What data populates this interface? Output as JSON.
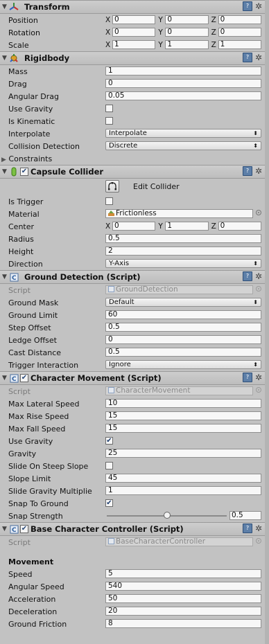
{
  "transform": {
    "title": "Transform",
    "axes": [
      "X",
      "Y",
      "Z"
    ],
    "rows": [
      {
        "label": "Position",
        "x": "0",
        "y": "0",
        "z": "0"
      },
      {
        "label": "Rotation",
        "x": "0",
        "y": "0",
        "z": "0"
      },
      {
        "label": "Scale",
        "x": "1",
        "y": "1",
        "z": "1"
      }
    ]
  },
  "rigidbody": {
    "title": "Rigidbody",
    "mass_label": "Mass",
    "mass": "1",
    "drag_label": "Drag",
    "drag": "0",
    "angular_drag_label": "Angular Drag",
    "angular_drag": "0.05",
    "use_gravity_label": "Use Gravity",
    "use_gravity": false,
    "is_kinematic_label": "Is Kinematic",
    "is_kinematic": false,
    "interpolate_label": "Interpolate",
    "interpolate": "Interpolate",
    "collision_detection_label": "Collision Detection",
    "collision_detection": "Discrete",
    "constraints_label": "Constraints"
  },
  "capsule": {
    "title": "Capsule Collider",
    "enabled": true,
    "edit_label": "Edit Collider",
    "is_trigger_label": "Is Trigger",
    "is_trigger": false,
    "material_label": "Material",
    "material": "Frictionless",
    "center_label": "Center",
    "center_x": "0",
    "center_y": "1",
    "center_z": "0",
    "radius_label": "Radius",
    "radius": "0.5",
    "height_label": "Height",
    "height": "2",
    "direction_label": "Direction",
    "direction": "Y-Axis"
  },
  "ground": {
    "title": "Ground Detection (Script)",
    "script_label": "Script",
    "script": "GroundDetection",
    "ground_mask_label": "Ground Mask",
    "ground_mask": "Default",
    "ground_limit_label": "Ground Limit",
    "ground_limit": "60",
    "step_offset_label": "Step Offset",
    "step_offset": "0.5",
    "ledge_offset_label": "Ledge Offset",
    "ledge_offset": "0",
    "cast_distance_label": "Cast Distance",
    "cast_distance": "0.5",
    "trigger_interaction_label": "Trigger Interaction",
    "trigger_interaction": "Ignore"
  },
  "movement": {
    "title": "Character Movement (Script)",
    "enabled": true,
    "script_label": "Script",
    "script": "CharacterMovement",
    "max_lateral_speed_label": "Max Lateral Speed",
    "max_lateral_speed": "10",
    "max_rise_speed_label": "Max Rise Speed",
    "max_rise_speed": "15",
    "max_fall_speed_label": "Max Fall Speed",
    "max_fall_speed": "15",
    "use_gravity_label": "Use Gravity",
    "use_gravity": true,
    "gravity_label": "Gravity",
    "gravity": "25",
    "slide_on_steep_label": "Slide On Steep Slope",
    "slide_on_steep": false,
    "slope_limit_label": "Slope Limit",
    "slope_limit": "45",
    "slide_gravity_label": "Slide Gravity Multiplie",
    "slide_gravity": "1",
    "snap_to_ground_label": "Snap To Ground",
    "snap_to_ground": true,
    "snap_strength_label": "Snap Strength",
    "snap_strength": "0.5",
    "snap_strength_fraction": 0.5
  },
  "controller": {
    "title": "Base Character Controller (Script)",
    "enabled": true,
    "script_label": "Script",
    "script": "BaseCharacterController",
    "section_movement": "Movement",
    "speed_label": "Speed",
    "speed": "5",
    "angular_speed_label": "Angular Speed",
    "angular_speed": "540",
    "acceleration_label": "Acceleration",
    "acceleration": "50",
    "deceleration_label": "Deceleration",
    "deceleration": "20",
    "ground_friction_label": "Ground Friction",
    "ground_friction": "8"
  },
  "checkmark": "✔"
}
